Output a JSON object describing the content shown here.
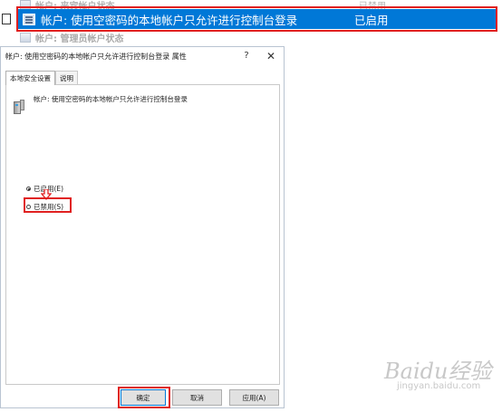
{
  "policy_list": {
    "rows_faded": [
      {
        "name": "帐户: 来宾帐户状态",
        "state": "已禁用"
      },
      {
        "name": "帐户: 管理员帐户状态",
        "state": ""
      }
    ],
    "selected_row": {
      "name": "帐户: 使用空密码的本地帐户只允许进行控制台登录",
      "state": "已启用"
    }
  },
  "dialog": {
    "title": "帐户: 使用空密码的本地帐户只允许进行控制台登录 属性",
    "help_label": "?",
    "close_label": "✕",
    "tabs": [
      {
        "label": "本地安全设置",
        "active": true
      },
      {
        "label": "说明",
        "active": false
      }
    ],
    "policy_label": "帐户: 使用空密码的本地帐户只允许进行控制台登录",
    "options": [
      {
        "label": "已启用(E)",
        "checked": true
      },
      {
        "label": "已禁用(S)",
        "checked": false
      }
    ],
    "buttons": {
      "ok": "确定",
      "cancel": "取消",
      "apply": "应用(A)"
    }
  },
  "annotations": {
    "highlight_color": "#e02020",
    "accent_color": "#0078d7"
  },
  "watermark": {
    "brand": "Baidu经验",
    "sub": "jingyan.baidu.com"
  }
}
